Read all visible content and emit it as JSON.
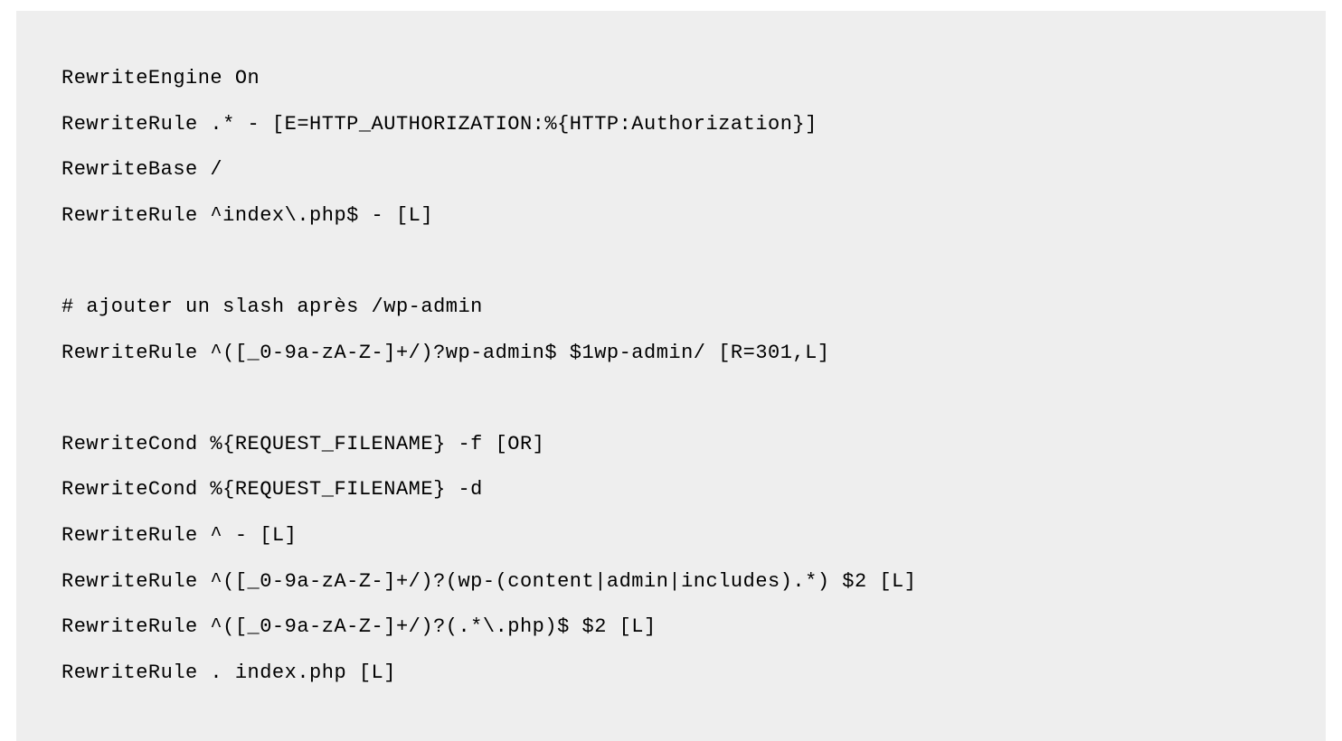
{
  "code": {
    "lines": [
      "RewriteEngine On",
      "RewriteRule .* - [E=HTTP_AUTHORIZATION:%{HTTP:Authorization}]",
      "RewriteBase /",
      "RewriteRule ^index\\.php$ - [L]",
      "",
      "# ajouter un slash après /wp-admin",
      "RewriteRule ^([_0-9a-zA-Z-]+/)?wp-admin$ $1wp-admin/ [R=301,L]",
      "",
      "RewriteCond %{REQUEST_FILENAME} -f [OR]",
      "RewriteCond %{REQUEST_FILENAME} -d",
      "RewriteRule ^ - [L]",
      "RewriteRule ^([_0-9a-zA-Z-]+/)?(wp-(content|admin|includes).*) $2 [L]",
      "RewriteRule ^([_0-9a-zA-Z-]+/)?(.*\\.php)$ $2 [L]",
      "RewriteRule . index.php [L]"
    ]
  }
}
